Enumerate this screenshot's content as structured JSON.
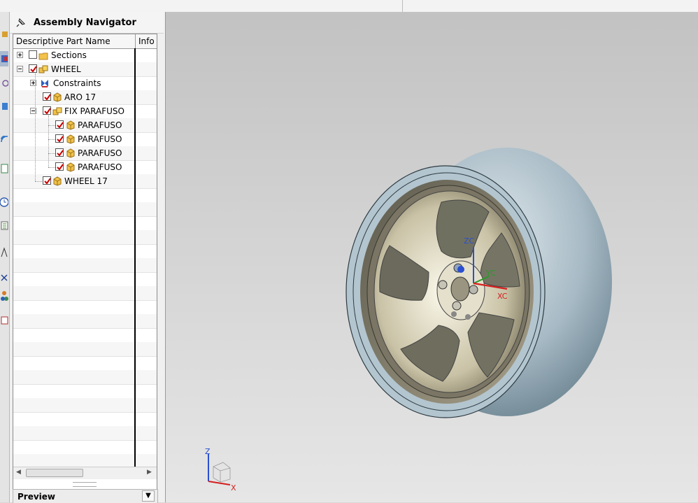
{
  "navigator": {
    "title": "Assembly Navigator",
    "columns": {
      "name": "Descriptive Part Name",
      "info": "Info"
    },
    "rows": [
      {
        "label": "Sections",
        "checked": false
      },
      {
        "label": "WHEEL",
        "checked": true
      },
      {
        "label": "Constraints"
      },
      {
        "label": "ARO 17",
        "checked": true
      },
      {
        "label": "FIX PARAFUSO",
        "checked": true
      },
      {
        "label": "PARAFUSO",
        "checked": true
      },
      {
        "label": "PARAFUSO",
        "checked": true
      },
      {
        "label": "PARAFUSO",
        "checked": true
      },
      {
        "label": "PARAFUSO",
        "checked": true
      },
      {
        "label": "WHEEL 17",
        "checked": true
      }
    ],
    "preview_label": "Preview"
  },
  "viewport": {
    "wcs_labels": {
      "z": "ZC",
      "y": "YC",
      "x": "XC"
    },
    "triad_labels": {
      "z": "Z",
      "x": "X"
    }
  },
  "colors": {
    "tire": "#9fb3bf",
    "rim": "#c7c0a4",
    "check": "#cc0000",
    "x_axis": "#d42020",
    "y_axis": "#2a9a2a",
    "z_axis": "#2a4fd0"
  },
  "icons": [
    "pin-icon",
    "folder-icon",
    "assembly-icon",
    "constraints-icon",
    "component-icon"
  ]
}
